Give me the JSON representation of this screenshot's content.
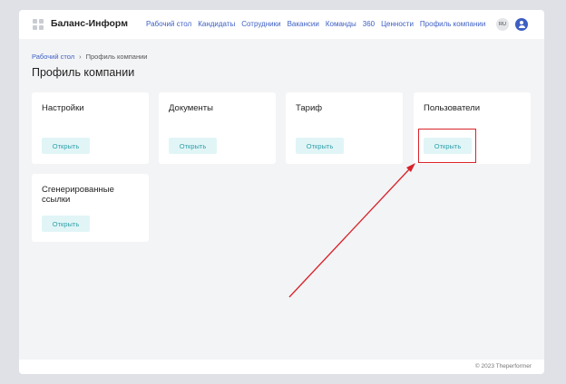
{
  "brand": {
    "name": "Баланс-Информ"
  },
  "nav": {
    "items": [
      "Рабочий стол",
      "Кандидаты",
      "Сотрудники",
      "Вакансии",
      "Команды",
      "360",
      "Ценности",
      "Профиль компании"
    ]
  },
  "topbar": {
    "lang": "RU",
    "user_icon": "user-icon"
  },
  "breadcrumb": {
    "home": "Рабочий стол",
    "separator": "›",
    "current": "Профиль компании"
  },
  "page": {
    "title": "Профиль компании"
  },
  "cards": [
    {
      "title": "Настройки",
      "button": "Открыть"
    },
    {
      "title": "Документы",
      "button": "Открыть"
    },
    {
      "title": "Тариф",
      "button": "Открыть"
    },
    {
      "title": "Пользователи",
      "button": "Открыть"
    },
    {
      "title": "Сгенерированные ссылки",
      "button": "Открыть"
    }
  ],
  "footer": {
    "copyright": "© 2023 Theperformer"
  },
  "colors": {
    "accent": "#3d5fc4",
    "button_bg": "#e1f5f7",
    "button_text": "#2f9fa8",
    "annotation": "#d8232a"
  }
}
